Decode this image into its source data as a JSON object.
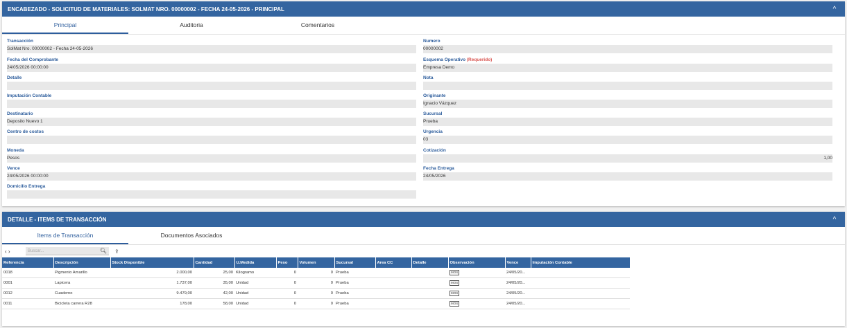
{
  "header": {
    "title": "ENCABEZADO - SOLICITUD DE MATERIALES: SOLMAT NRO. 00000002 - FECHA 24-05-2026 - PRINCIPAL",
    "chevron": "^"
  },
  "tabs": [
    "Principal",
    "Auditoria",
    "Comentarios"
  ],
  "fields": [
    {
      "label": "Transacción",
      "value": "SolMat Nro.  00000002 - Fecha 24-05-2026"
    },
    {
      "label": "Fecha del Comprobante",
      "value": "24/05/2026 00:00:00"
    },
    {
      "label": "Detalle",
      "value": ""
    },
    {
      "label": "Imputación Contable",
      "value": ""
    },
    {
      "label": "Destinatario",
      "value": "Deposito Nuevo 1"
    },
    {
      "label": "Centro de costos",
      "value": ""
    },
    {
      "label": "Moneda",
      "value": "Pesos"
    },
    {
      "label": "Vence",
      "value": "24/05/2026 00:00:00"
    },
    {
      "label": "Domicilio Entrega",
      "value": ""
    },
    {
      "label": "Numero",
      "value": "00000002"
    },
    {
      "label": "Esquema Operativo",
      "required": "(Requerido)",
      "value": "Empresa Demo"
    },
    {
      "label": "Nota",
      "value": ""
    },
    {
      "label": "Originante",
      "value": "Ignacio Vázquez"
    },
    {
      "label": "Sucursal",
      "value": "Prueba"
    },
    {
      "label": "Urgencia",
      "value": "03"
    },
    {
      "label": "Cotización",
      "value": "1,00"
    },
    {
      "label": "Fecha Entrega",
      "value": "24/05/2026"
    }
  ],
  "detail": {
    "title": "DETALLE - ITEMS DE TRANSACCIÓN",
    "chevron": "^",
    "tabs": [
      "Items de Transacción",
      "Documentos Asociados"
    ],
    "nav": "‹ ›",
    "search_placeholder": "Buscar...",
    "columns": [
      "Referencia",
      "Descripción",
      "Stock Disponible",
      "Cantidad",
      "U.Medida",
      "Peso",
      "Volumen",
      "Sucursal",
      "Area CC",
      "Detalle",
      "Observación",
      "Vence",
      "Imputación Contable"
    ],
    "rows": [
      [
        "0018",
        "Pigmento Amarillo",
        "2.000,00",
        "25,00",
        "Kilogramo",
        "0",
        "0",
        "Prueba",
        "",
        "",
        "MOS",
        "24/05/20...",
        ""
      ],
      [
        "0001",
        "Lapicera",
        "1.737,00",
        "35,00",
        "Unidad",
        "0",
        "0",
        "Prueba",
        "",
        "",
        "MOS",
        "24/05/20...",
        ""
      ],
      [
        "0012",
        "Cuaderno",
        "9.479,00",
        "42,00",
        "Unidad",
        "0",
        "0",
        "Prueba",
        "",
        "",
        "MOS",
        "24/05/20...",
        ""
      ],
      [
        "0011",
        "Bicicleta carrera R28",
        "178,00",
        "58,00",
        "Unidad",
        "0",
        "0",
        "Prueba",
        "",
        "",
        "MOS",
        "24/05/20...",
        ""
      ]
    ]
  }
}
